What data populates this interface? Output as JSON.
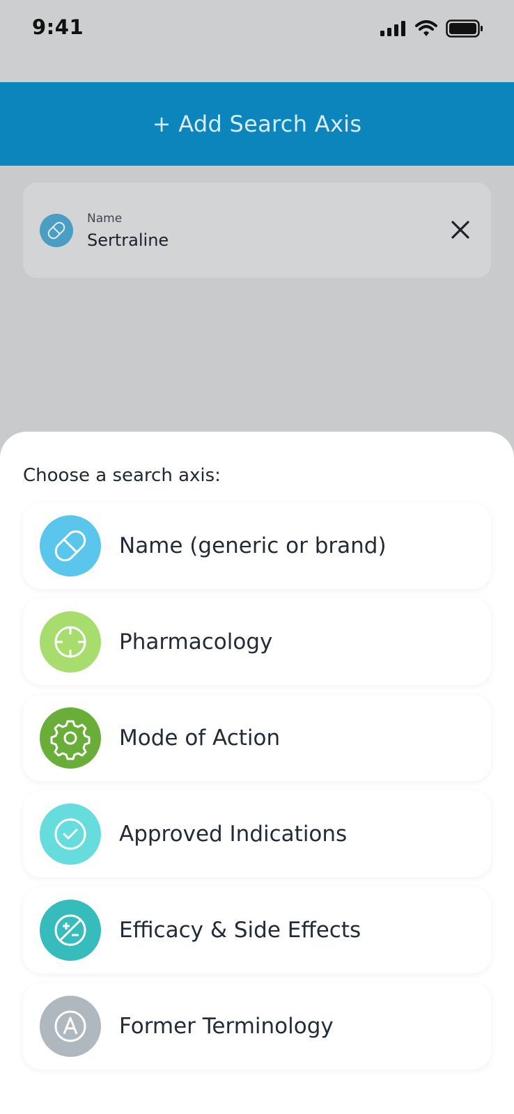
{
  "status_bar": {
    "time": "9:41"
  },
  "add_axis": {
    "label": "+ Add Search Axis",
    "color": "#0c85bd"
  },
  "selected_axis": {
    "label": "Name",
    "value": "Sertraline",
    "icon": "pill-icon"
  },
  "sheet": {
    "title": "Choose a search axis:",
    "options": [
      {
        "label": "Name (generic or brand)",
        "icon": "pill-icon",
        "color": "#5bc6ec"
      },
      {
        "label": "Pharmacology",
        "icon": "crosshair-icon",
        "color": "#a6dd6c"
      },
      {
        "label": "Mode of Action",
        "icon": "gear-icon",
        "color": "#6aae3a"
      },
      {
        "label": "Approved Indications",
        "icon": "check-circle-icon",
        "color": "#66dcdc"
      },
      {
        "label": "Efficacy & Side Effects",
        "icon": "plus-minus-icon",
        "color": "#37bcbc"
      },
      {
        "label": "Former Terminology",
        "icon": "letter-a-icon",
        "color": "#b0b8bf"
      }
    ]
  }
}
